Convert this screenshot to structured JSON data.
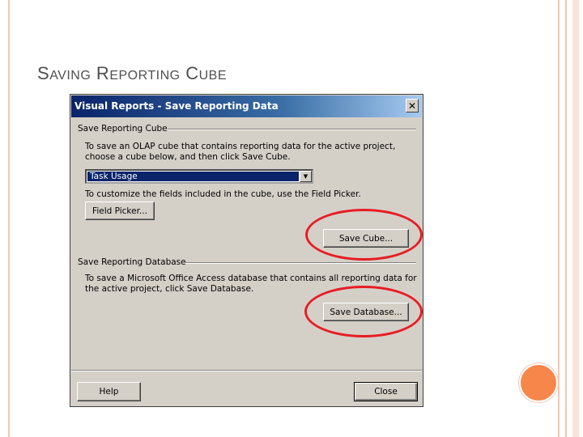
{
  "slide": {
    "title_parts": [
      {
        "cap": "S",
        "rest": "AVING"
      },
      {
        "cap": "R",
        "rest": "EPORTING"
      },
      {
        "cap": "C",
        "rest": "UBE"
      }
    ]
  },
  "dialog": {
    "title": "Visual Reports - Save Reporting Data",
    "close_glyph": "✕",
    "cube_group": {
      "label": "Save Reporting Cube",
      "description_line1": "To save an OLAP cube that contains reporting data for the active project,",
      "description_line2": "choose a cube below, and then click Save Cube.",
      "cube_select_value": "Task Usage",
      "customize_text": "To customize the fields included in the cube, use the Field Picker.",
      "field_picker_label": "Field Picker...",
      "save_cube_label": "Save Cube..."
    },
    "database_group": {
      "label": "Save Reporting Database",
      "description_line1": "To save a Microsoft Office Access database that contains all reporting data for",
      "description_line2": "the active project, click Save Database.",
      "save_database_label": "Save Database..."
    },
    "help_label": "Help",
    "close_label": "Close"
  },
  "colors": {
    "annotation_red": "#e81c24",
    "titlebar_blue": "#0a246a",
    "accent_orange": "#f7864b"
  }
}
